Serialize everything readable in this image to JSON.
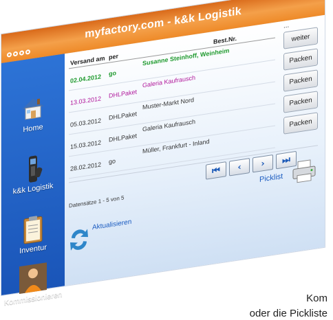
{
  "window": {
    "title": "myfactory.com - k&k Logistik"
  },
  "sidebar": {
    "items": [
      {
        "label": "Home"
      },
      {
        "label": "k&k Logistik"
      },
      {
        "label": "Inventur"
      },
      {
        "label": "Kommissionieren"
      }
    ]
  },
  "table": {
    "headers": {
      "versand": "Versand am",
      "per": "per",
      "bestnr": "Best.Nr."
    },
    "extra_header": "...",
    "rows": [
      {
        "date": "02.04.2012",
        "per": "go",
        "customer": "Susanne Steinhoff, Weinheim",
        "color": "#1f9a2e"
      },
      {
        "date": "13.03.2012",
        "per": "DHLPaket",
        "customer": "Galeria Kaufrausch",
        "color": "#b0169a"
      },
      {
        "date": "05.03.2012",
        "per": "DHLPaket",
        "customer": "Muster-Markt Nord",
        "color": "#333333"
      },
      {
        "date": "15.03.2012",
        "per": "DHLPaket",
        "customer": "Galeria Kaufrausch",
        "color": "#333333"
      },
      {
        "date": "28.02.2012",
        "per": "go",
        "customer": "Müller, Frankfurt - Inland",
        "color": "#333333"
      }
    ]
  },
  "buttons": {
    "weiter": "weiter",
    "packen": "Packen"
  },
  "pager": {
    "first": "⏮",
    "prev": "‹",
    "next": "›",
    "last": "⏭"
  },
  "records_text": "Datensätze 1 - 5 von 5",
  "picklist_label": "Picklist",
  "refresh_label": "Aktualisieren",
  "caption": {
    "line1": "Kom",
    "line2": "oder die Pickliste"
  },
  "colors": {
    "title_orange": "#ee8a28",
    "sidebar_blue": "#1a55b8",
    "link_blue": "#1a5bc0"
  }
}
